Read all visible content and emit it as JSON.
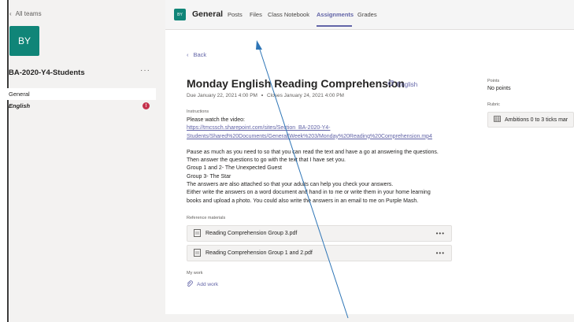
{
  "sidebar": {
    "back_label": "All teams",
    "team_initials": "BY",
    "team_name": "BA-2020-Y4-Students",
    "more_glyph": "···",
    "channels": [
      {
        "label": "General"
      },
      {
        "label": "English",
        "badge": "!"
      }
    ]
  },
  "header": {
    "channel_initials": "BY",
    "channel_name": "General",
    "tabs": [
      "Posts",
      "Files",
      "Class Notebook",
      "Assignments",
      "Grades"
    ],
    "active_tab": "Assignments"
  },
  "assignment": {
    "back_label": "Back",
    "title": "Monday English Reading Comprehension",
    "tag": "English",
    "due": "Due January 22, 2021 4:00 PM",
    "closes": "Closes January 24, 2021 4:00 PM",
    "instructions_label": "Instructions",
    "instructions": {
      "line1": "Please watch the video:",
      "link1": "https://tmcssch.sharepoint.com/sites/Section_BA-2020-Y4-",
      "link2": "Students/Shared%20Documents/General/Week%203/Monday%20Reading%20Comprehension.mp4",
      "p1": "Pause as much as you need to so that you can read the text and have a go at answering the questions.",
      "p2": "Then answer the questions to go with the text that I have set you.",
      "p3": "Group 1 and 2- The Unexpected Guest",
      "p4": "Group 3- The Star",
      "p5": "The answers are also attached so that your adults can help you check your answers.",
      "p6": "Either write the answers on a word document and hand in to me or write them in your home learning",
      "p7": "books and upload a photo. You could also write the answers in an email to me on Purple Mash."
    },
    "reference_label": "Reference materials",
    "references": [
      {
        "name": "Reading Comprehension Group 3.pdf"
      },
      {
        "name": "Reading Comprehension Group 1 and 2.pdf"
      }
    ],
    "my_work_label": "My work",
    "add_work_label": "Add work"
  },
  "details": {
    "points_label": "Points",
    "points_value": "No points",
    "rubric_label": "Rubric",
    "rubric_value": "Ambitions 0 to 3 ticks mar"
  },
  "colors": {
    "accent": "#6264a7",
    "team": "#108578",
    "badge": "#c4314b",
    "annotation_arrow": "#2e75b6"
  }
}
